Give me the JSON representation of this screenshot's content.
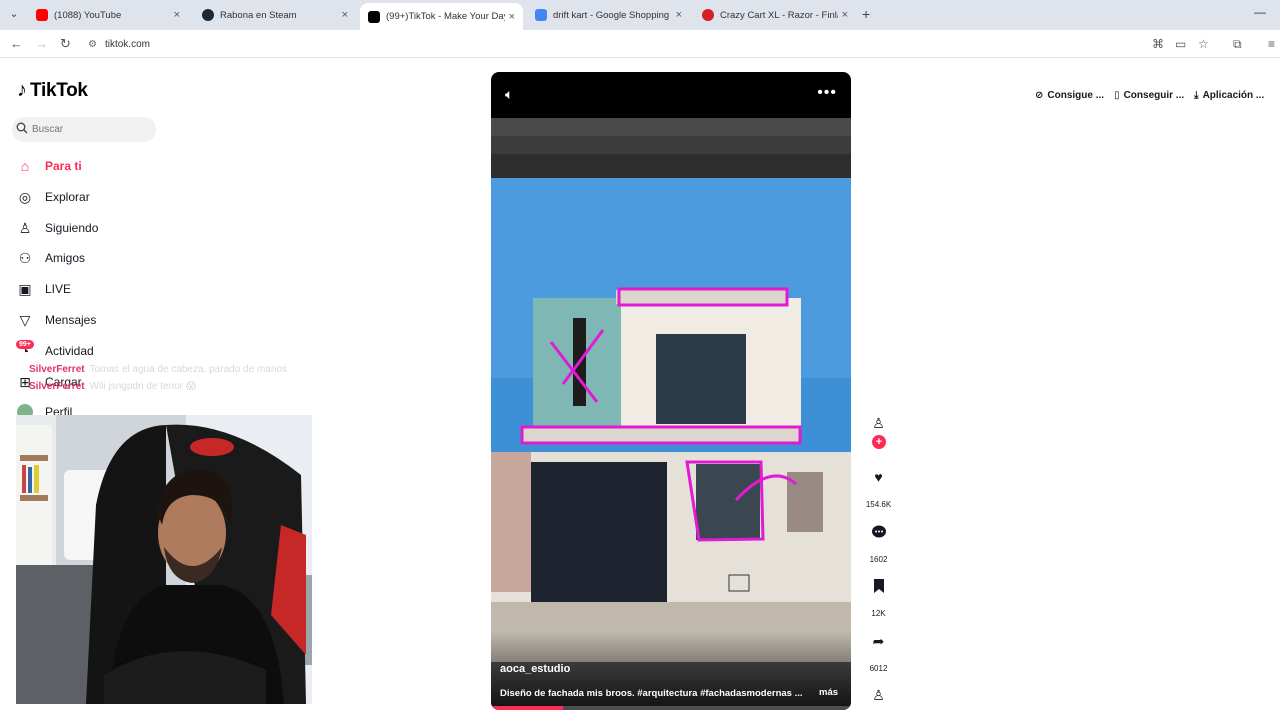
{
  "browser": {
    "tabs": [
      {
        "title": "(1088) YouTube",
        "favicon_color": "#ff0000",
        "active": false
      },
      {
        "title": "Rabona en Steam",
        "favicon_color": "#1b2838",
        "active": false
      },
      {
        "title": "(99+)TikTok - Make Your Day",
        "favicon_color": "#000000",
        "active": true
      },
      {
        "title": "drift kart - Google Shopping",
        "favicon_color": "#4285f4",
        "active": false
      },
      {
        "title": "Crazy Cart XL - Razor - Finland",
        "favicon_color": "#d32027",
        "active": false
      }
    ],
    "close_glyph": "×",
    "new_tab_glyph": "+",
    "url": "tiktok.com"
  },
  "tiktok": {
    "logo_text": "TikTok",
    "search_placeholder": "Buscar",
    "nav": [
      {
        "label": "Para ti",
        "icon": "home-icon",
        "active": true
      },
      {
        "label": "Explorar",
        "icon": "compass-icon",
        "active": false
      },
      {
        "label": "Siguiendo",
        "icon": "following-icon",
        "active": false
      },
      {
        "label": "Amigos",
        "icon": "friends-icon",
        "active": false
      },
      {
        "label": "LIVE",
        "icon": "live-icon",
        "active": false
      },
      {
        "label": "Mensajes",
        "icon": "send-icon",
        "active": false
      },
      {
        "label": "Actividad",
        "icon": "bell-icon",
        "active": false
      },
      {
        "label": "Cargar",
        "icon": "upload-icon",
        "active": false
      },
      {
        "label": "Perfil",
        "icon": "avatar",
        "active": false
      }
    ],
    "activity_badge": "99+",
    "accent": "#fe2c55"
  },
  "chat": [
    {
      "user": "SilverFerret",
      "message": "Tomas el agua de cabeza, parado de manos"
    },
    {
      "user": "SilverFerret",
      "message": "Wili jsngpdn de tenor 😱"
    }
  ],
  "video": {
    "author": "aoca_estudio",
    "caption": "Diseño de fachada mis broos. #arquitectura #fachadasmodernas ...",
    "more_label": "más",
    "progress": 0.2,
    "likes": "154.6K",
    "comments": "1602",
    "saves": "12K",
    "shares": "6012"
  },
  "top_actions": [
    {
      "label": "Consigue ...",
      "icon": "coin-icon"
    },
    {
      "label": "Conseguir ...",
      "icon": "phone-icon"
    },
    {
      "label": "Aplicación ...",
      "icon": "download-icon"
    }
  ]
}
